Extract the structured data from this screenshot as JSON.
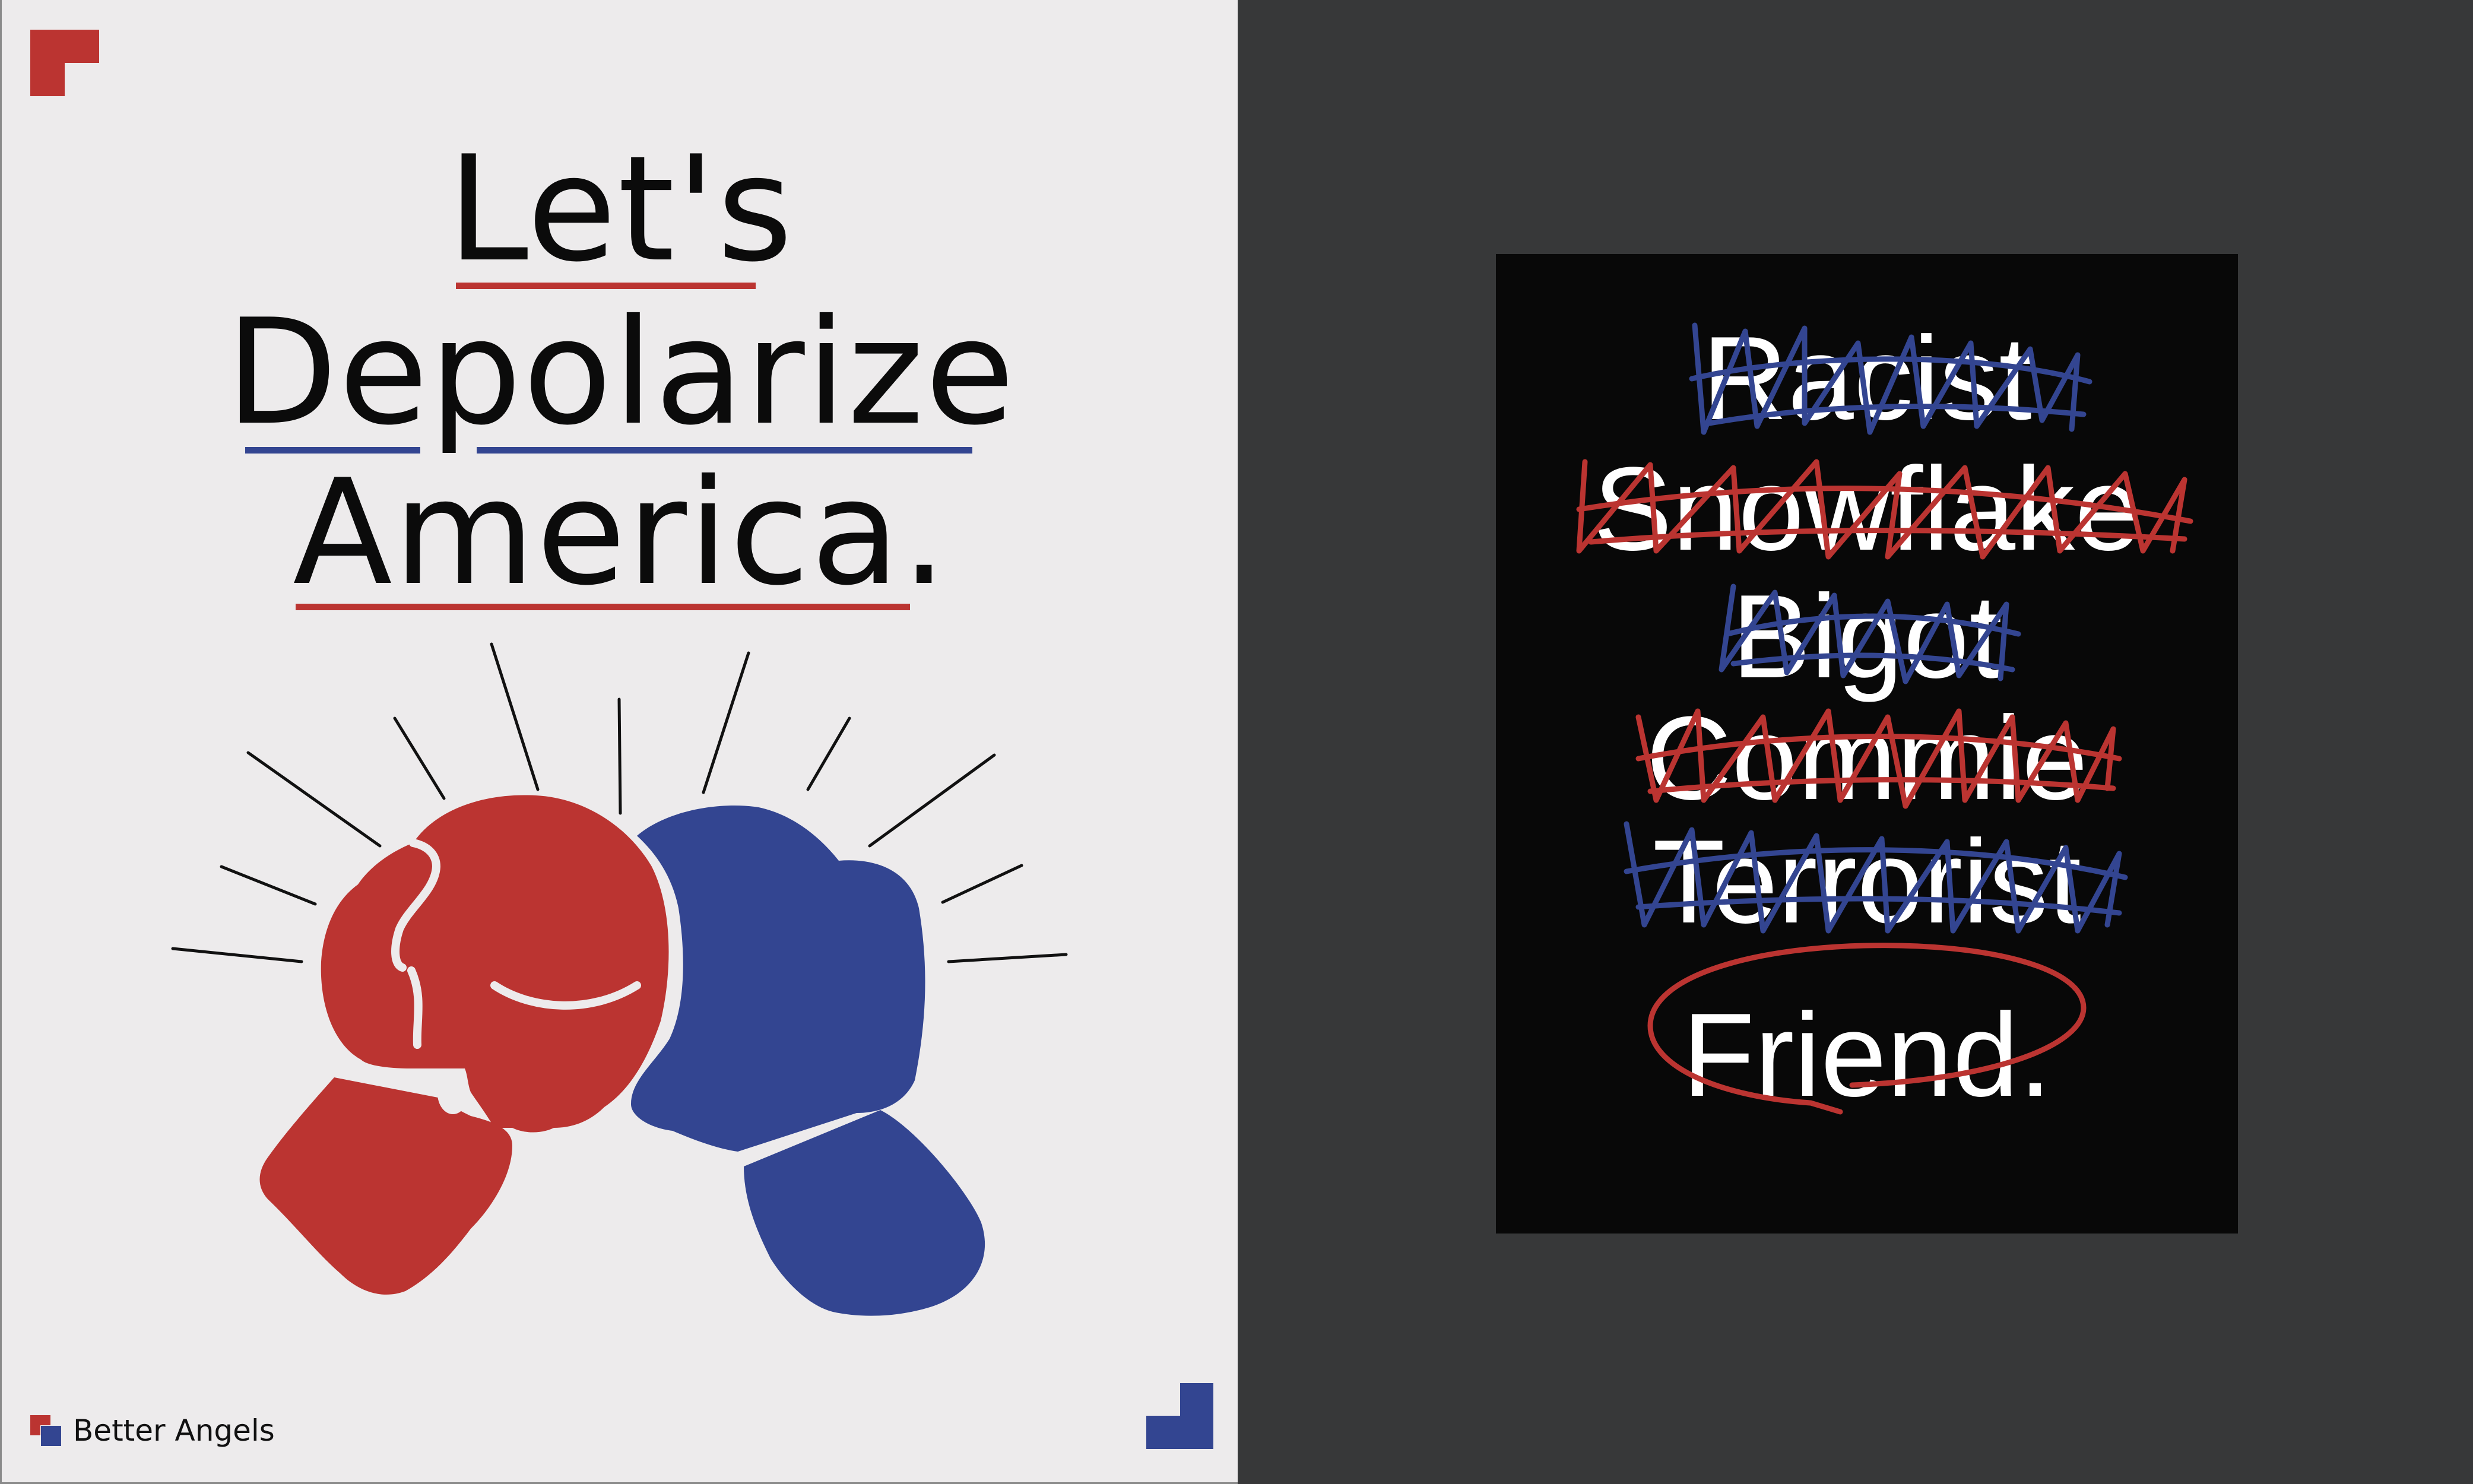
{
  "left_poster": {
    "headline": {
      "line1": "Let's",
      "line2": "Depolarize",
      "line3": "America."
    },
    "brand": {
      "name": "Better Angels",
      "logo_icon": "better-angels-logo-icon"
    },
    "icons": [
      "corner-bracket-icon",
      "boxing-gloves-icon",
      "impact-lines-icon"
    ]
  },
  "right_poster": {
    "crossed_out_words": [
      "Racist",
      "Snowflake",
      "Bigot",
      "Commie",
      "Terrorist"
    ],
    "circled_word": "Friend."
  },
  "colors": {
    "red": "#bb3431",
    "blue": "#334591",
    "poster_bg": "#edebec",
    "dark_panel": "#373839",
    "black_poster": "#080808",
    "text_dark": "#0b0b0b",
    "text_light": "#ffffff"
  }
}
